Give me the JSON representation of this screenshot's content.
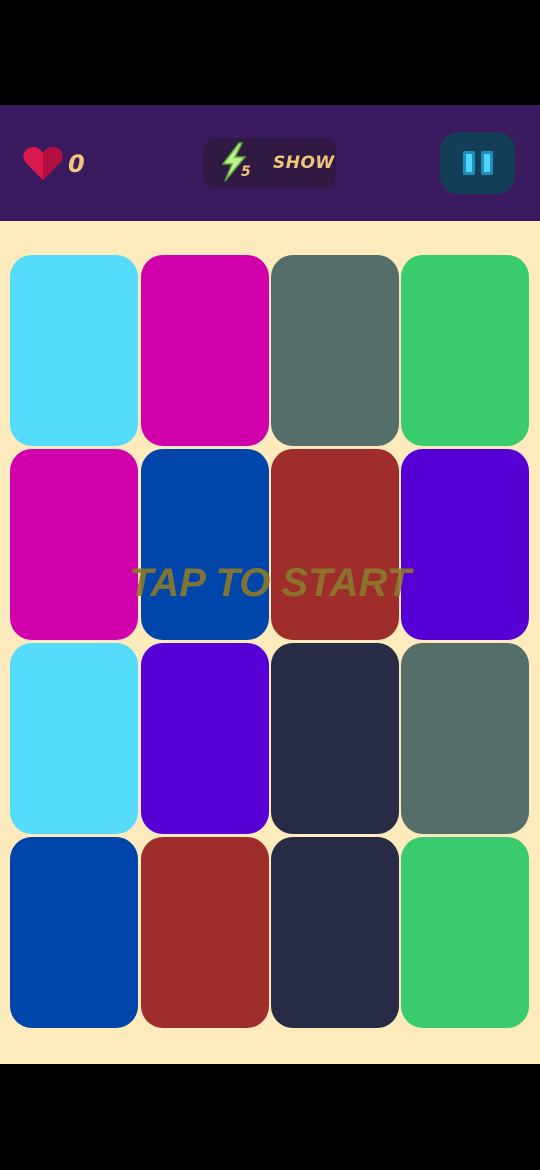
{
  "header": {
    "lives": {
      "icon": "heart-icon",
      "count": "0",
      "color": "#d8184f"
    },
    "powerup": {
      "icon": "lightning-bolt-icon",
      "count": "5",
      "label": "SHOW"
    },
    "pause": {
      "icon": "pause-icon"
    }
  },
  "board": {
    "overlay_text": "TAP TO START",
    "background": "#fdebbd",
    "tiles": [
      {
        "color": "#55dcfd"
      },
      {
        "color": "#d000ab"
      },
      {
        "color": "#566e69"
      },
      {
        "color": "#3acb6e"
      },
      {
        "color": "#d000ab"
      },
      {
        "color": "#0045a9"
      },
      {
        "color": "#9f2d2c"
      },
      {
        "color": "#5700d5"
      },
      {
        "color": "#55dcfd"
      },
      {
        "color": "#5700d5"
      },
      {
        "color": "#272b45"
      },
      {
        "color": "#566e69"
      },
      {
        "color": "#0045a9"
      },
      {
        "color": "#9f2d2c"
      },
      {
        "color": "#272b45"
      },
      {
        "color": "#3acb6e"
      }
    ]
  }
}
